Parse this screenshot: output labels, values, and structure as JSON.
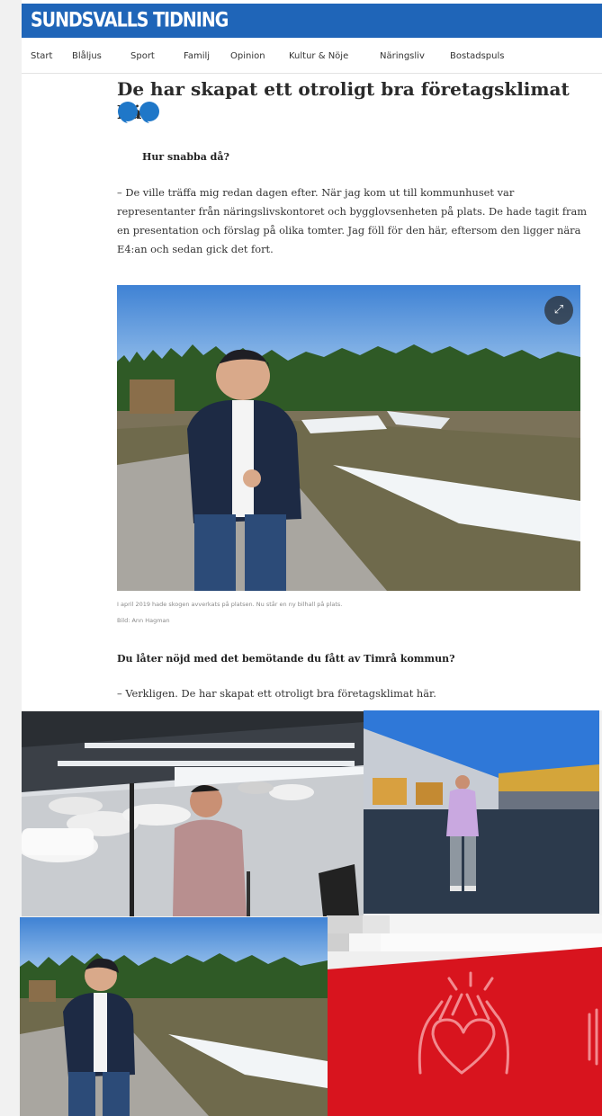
{
  "site": {
    "name": "SUNDSVALLS TIDNING"
  },
  "nav": {
    "items": [
      "Start",
      "Blåljus",
      "Sport",
      "Familj",
      "Opinion",
      "Kultur & Nöje",
      "Näringsliv",
      "Bostadspuls"
    ]
  },
  "article": {
    "headline": "De har skapat ett otroligt bra företagsklimat här",
    "question1": "Hur snabba då?",
    "paragraph1": "– De ville träffa mig redan dagen efter. När jag kom ut till kommunhuset var representanter från näringslivskontoret och bygglovsenheten på plats. De hade tagit fram en presentation och förslag på olika tomter. Jag föll för den här, eftersom den ligger nära E4:an och sedan gick det fort.",
    "photo_caption": "I april 2019 hade skogen avverkats på platsen. Nu står en ny bilhall på plats.",
    "photo_credit": "Bild: Ann Hagman",
    "question2": "Du låter nöjd med det bemötande du fått av Timrå kommun?",
    "paragraph2": "– Verkligen. De har skapat ett otroligt bra företagsklimat här."
  },
  "icons": {
    "expand": "expand-icon",
    "quote": "quote-icon",
    "heart_hands": "heart-hands-icon"
  },
  "colors": {
    "brand_blue": "#1f65b8",
    "quote_blue": "#1f77c8",
    "red_panel": "#d8141e"
  }
}
